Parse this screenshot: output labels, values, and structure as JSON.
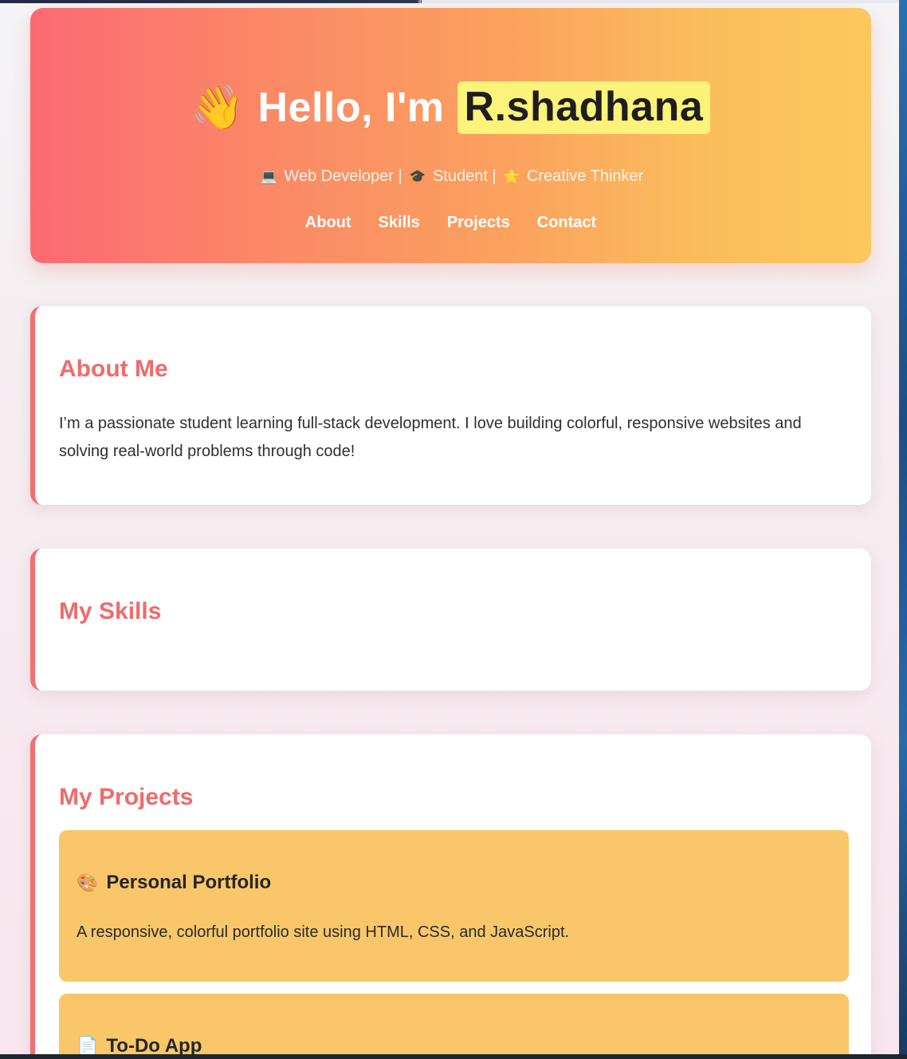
{
  "hero": {
    "wave_icon": "waving-hand",
    "greeting": "Hello, I'm",
    "name": "R.shadhana",
    "subtitle": {
      "part1_icon": "laptop",
      "part1": "Web Developer |",
      "part2_icon": "graduation-cap",
      "part2": "Student |",
      "part3_icon": "star",
      "part3": "Creative Thinker"
    },
    "nav": [
      "About",
      "Skills",
      "Projects",
      "Contact"
    ]
  },
  "about": {
    "title": "About Me",
    "text": "I’m a passionate student learning full-stack development. I love building colorful, responsive websites and solving real-world problems through code!"
  },
  "skills": {
    "title": "My Skills"
  },
  "projects": {
    "title": "My Projects",
    "items": [
      {
        "icon": "palette",
        "title": "Personal Portfolio",
        "description": "A responsive, colorful portfolio site using HTML, CSS, and JavaScript."
      },
      {
        "icon": "notepad",
        "title": "To-Do App"
      }
    ]
  },
  "colors": {
    "accent": "#ef6b6b",
    "highlight": "#fdf27a",
    "project_card": "#f9c76a"
  }
}
